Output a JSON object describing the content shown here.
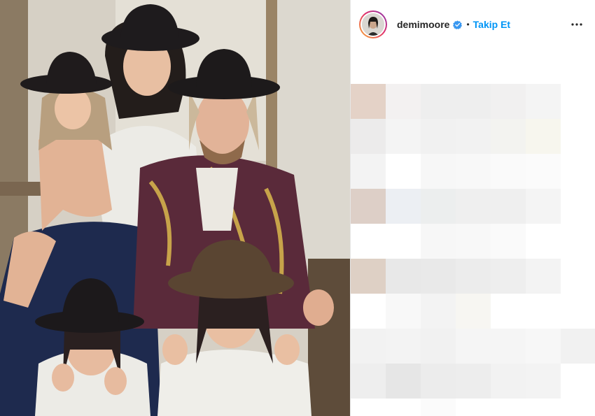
{
  "post": {
    "username": "demimoore",
    "separator": "•",
    "follow_label": "Takip Et",
    "verified_icon": "verified-badge-icon",
    "more_icon": "more-options-icon",
    "follow_color": "#0095f6"
  },
  "comments": {
    "state": "blurred"
  }
}
